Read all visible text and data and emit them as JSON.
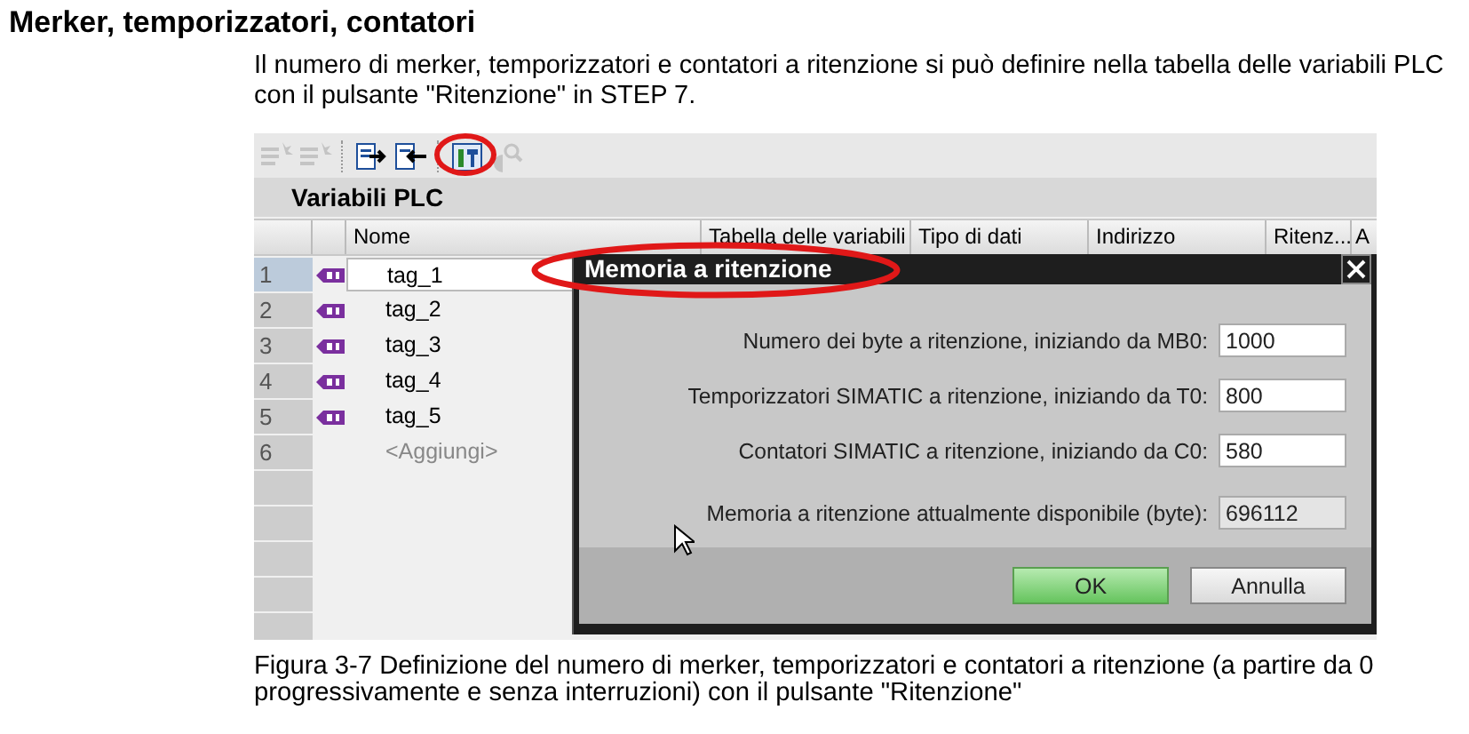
{
  "heading": "Merker, temporizzatori, contatori",
  "intro": "Il numero di merker, temporizzatori e contatori a ritenzione si può definire nella tabella delle variabili PLC con il pulsante \"Ritenzione\" in STEP 7.",
  "screenshot": {
    "toolbar": [
      {
        "disabled": true
      },
      {
        "disabled": true
      },
      {
        "disabled": false
      },
      {
        "disabled": false
      },
      {
        "disabled": false
      },
      {
        "disabled": true
      }
    ],
    "panel_title": "Variabili PLC",
    "columns": [
      "Nome",
      "Tabella delle variabili",
      "Tipo di dati",
      "Indirizzo",
      "Ritenz...",
      "A"
    ],
    "rows": [
      {
        "number": "1",
        "name": "tag_1",
        "kind": "tag",
        "selected": true
      },
      {
        "number": "2",
        "name": "tag_2",
        "kind": "tag",
        "selected": false
      },
      {
        "number": "3",
        "name": "tag_3",
        "kind": "tag",
        "selected": false
      },
      {
        "number": "4",
        "name": "tag_4",
        "kind": "tag",
        "selected": false
      },
      {
        "number": "5",
        "name": "tag_5",
        "kind": "tag",
        "selected": false
      },
      {
        "number": "6",
        "name": "<Aggiungi>",
        "kind": "add",
        "selected": false
      }
    ],
    "dialog": {
      "title": "Memoria a ritenzione",
      "fields": [
        {
          "label": "Numero dei byte a ritenzione, iniziando da MB0:",
          "value": "1000",
          "readonly": false
        },
        {
          "label": "Temporizzatori SIMATIC a ritenzione, iniziando da T0:",
          "value": "800",
          "readonly": false
        },
        {
          "label": "Contatori SIMATIC a ritenzione, iniziando da C0:",
          "value": "580",
          "readonly": false
        },
        {
          "label": "Memoria a ritenzione attualmente disponibile (byte):",
          "value": "696112",
          "readonly": true
        }
      ],
      "buttons": [
        {
          "label": "OK",
          "default": true
        },
        {
          "label": "Annulla",
          "default": false
        }
      ]
    }
  },
  "caption": "Figura 3-7  Definizione del numero di merker, temporizzatori e contatori a ritenzione (a partire da 0 progressivamente e senza interruzioni) con il pulsante \"Ritenzione\""
}
